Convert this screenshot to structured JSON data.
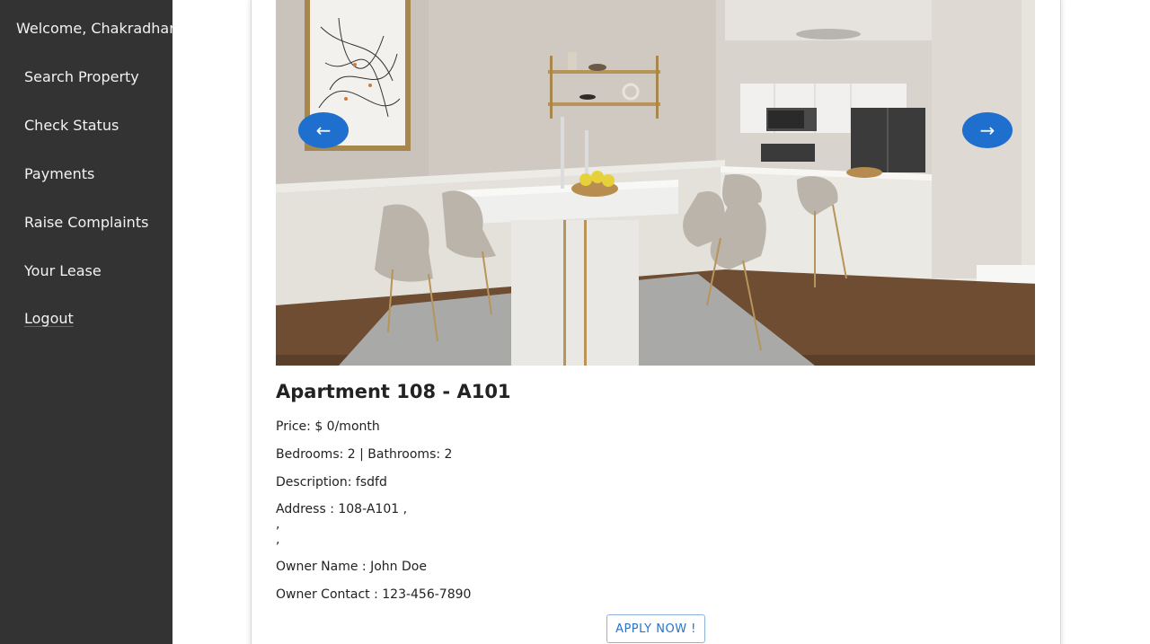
{
  "sidebar": {
    "welcome": "Welcome, Chakradhar",
    "items": [
      {
        "label": "Search Property"
      },
      {
        "label": "Check Status"
      },
      {
        "label": "Payments"
      },
      {
        "label": "Raise Complaints"
      },
      {
        "label": "Your Lease"
      },
      {
        "label": "Logout"
      }
    ]
  },
  "carousel": {
    "prev_label": "←",
    "next_label": "→"
  },
  "property": {
    "title": "Apartment 108 - A101",
    "price": "Price: $ 0/month",
    "rooms": "Bedrooms: 2 | Bathrooms: 2",
    "description": "Description: fsdfd",
    "address": "Address : 108-A101 ,",
    "address_line2": ",",
    "address_line3": ",",
    "owner_name": "Owner Name : John Doe",
    "owner_contact": "Owner Contact : 123-456-7890"
  },
  "apply_label": "APPLY NOW !",
  "colors": {
    "sidebar_bg": "#333333",
    "accent_blue": "#1f6fcf"
  }
}
